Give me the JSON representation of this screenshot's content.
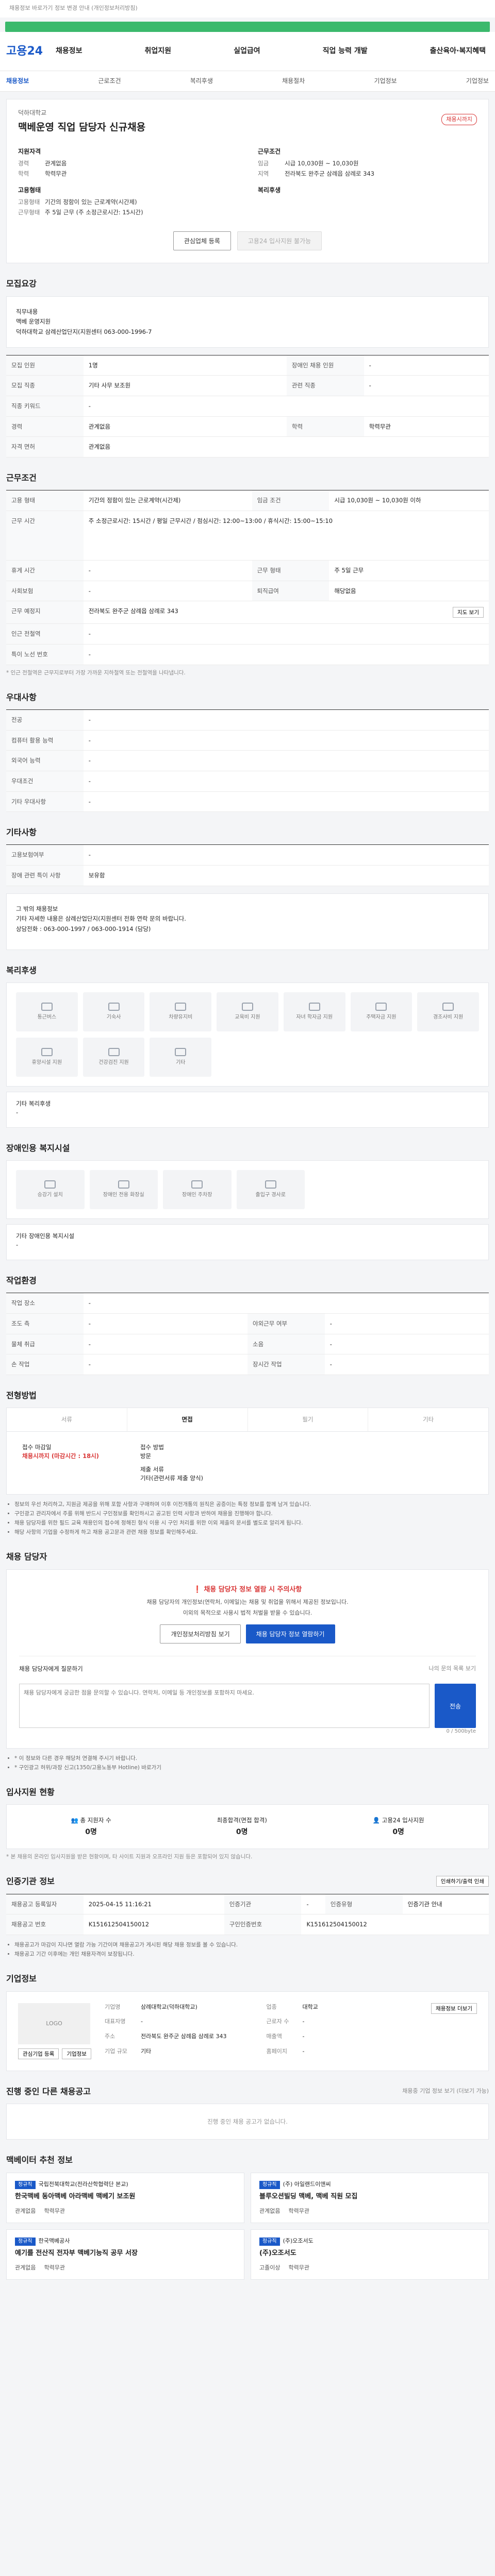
{
  "top": {
    "notice": "채용정보 바로가기 정보 변경 안내 (개인정보처리방침)"
  },
  "header": {
    "logo": "고용24",
    "nav": [
      "채용정보",
      "취업지원",
      "실업급여",
      "직업 능력 개발",
      "출산육아·복지혜택"
    ]
  },
  "subtabs": [
    "채용정보",
    "근로조건",
    "복리후생",
    "채용절차",
    "기업정보",
    "기업정보"
  ],
  "job": {
    "company": "덕하대학교",
    "title": "맥베운영 직업 담당자 신규채용",
    "badge": "채용시까지",
    "summary_left": {
      "title": "지원자격",
      "items": [
        {
          "k": "경력",
          "v": "관계없음"
        },
        {
          "k": "학력",
          "v": "학력무관"
        }
      ]
    },
    "summary_right": {
      "title": "근무조건",
      "items": [
        {
          "k": "임금",
          "v": "시급 10,030원 ~ 10,030원"
        },
        {
          "k": "지역",
          "v": "전라북도 완주군 삼례읍 삼례로 343"
        }
      ]
    },
    "summary_left2": {
      "title": "고용형태",
      "items": [
        {
          "k": "고용형태",
          "v": "기간의 정함이 있는 근로계약(시간제)"
        },
        {
          "k": "근무형태",
          "v": "주 5일 근무 (주 소정근로시간: 15시간)"
        }
      ]
    },
    "summary_right2": {
      "title": "복리후생",
      "items": [
        {
          "k": "",
          "v": ""
        }
      ]
    },
    "btn_interest": "관심업체 등록",
    "btn_apply": "고용24 입사지원 불가능"
  },
  "recruit": {
    "heading": "모집요강",
    "box": [
      "직무내용",
      "맥베 운영지원",
      "덕하대학교 삼례산업단지(지원센터 063-000-1996-7"
    ],
    "rows": [
      {
        "k": "모집 인원",
        "v": "1명",
        "k2": "장애인 채용 인원",
        "v2": "-"
      },
      {
        "k": "모집 직종",
        "v": "기타 사무 보조원",
        "k2": "관련 직종",
        "v2": "-"
      },
      {
        "k": "직종 키워드",
        "v": "-",
        "k2": "",
        "v2": ""
      },
      {
        "k": "경력",
        "v": "관계없음",
        "k2": "학력",
        "v2": "학력무관"
      },
      {
        "k": "자격 면허",
        "v": "관계없음",
        "k2": "",
        "v2": ""
      }
    ]
  },
  "conditions": {
    "heading": "근무조건",
    "rows": [
      {
        "k": "고용 형태",
        "v": "기간의 정함이 있는 근로계약(시간제)",
        "k2": "임금 조건",
        "v2": "시급 10,030원 ~ 10,030원 이하"
      },
      {
        "k": "근무 시간",
        "v": "주 소정근로시간: 15시간 / 평일 근무시간 / 점심시간: 12:00~13:00 / 휴식시간: 15:00~15:10",
        "k2": "",
        "v2": ""
      },
      {
        "k": "휴게 시간",
        "v": "-",
        "k2": "근무 형태",
        "v2": "주 5일 근무"
      },
      {
        "k": "사회보험",
        "v": "-",
        "k2": "퇴직급여",
        "v2": "해당없음"
      },
      {
        "k": "근무 예정지",
        "v": "전라북도 완주군 삼례읍 삼례로 343",
        "k2": "",
        "v2": ""
      },
      {
        "k": "인근 전철역",
        "v": "-",
        "k2": "",
        "v2": ""
      },
      {
        "k": "특이 노선 번호",
        "v": "-",
        "k2": "",
        "v2": ""
      }
    ],
    "map_btn": "지도 보기",
    "note": "* 인근 전철역은 근무지로부터 가장 가까운 지하철역 또는 전철역을 나타냅니다."
  },
  "preference": {
    "heading": "우대사항",
    "rows": [
      {
        "k": "전공",
        "v": "-"
      },
      {
        "k": "컴퓨터 활용 능력",
        "v": "-"
      },
      {
        "k": "외국어 능력",
        "v": "-"
      },
      {
        "k": "우대조건",
        "v": "-"
      },
      {
        "k": "기타 우대사항",
        "v": "-"
      }
    ]
  },
  "etc": {
    "heading": "기타사항",
    "rows": [
      {
        "k": "고용보험여부",
        "v": "-"
      },
      {
        "k": "장애 관련 특이 사항",
        "v": "보유함"
      }
    ],
    "box": [
      "그 밖의 채용정보",
      "기타 자세한 내용은 삼례산업단지(지원센터 전화 연락 문의 바랍니다.",
      "상담전화 : 063-000-1997 / 063-000-1914 (담당)"
    ]
  },
  "welfare": {
    "heading": "복리후생",
    "items": [
      "통근버스",
      "기숙사",
      "차량유지비",
      "교육비 지원",
      "자녀 학자금 지원",
      "주택자금 지원",
      "경조사비 지원",
      "휴양시설 지원",
      "건강검진 지원",
      "기타"
    ],
    "extra_title": "기타 복리후생",
    "extra": "-"
  },
  "disabled": {
    "heading": "장애인용 복지시설",
    "items": [
      "승강기 설치",
      "장애인 전용 화장실",
      "장애인 주차장",
      "출입구 경사로"
    ],
    "extra_title": "기타 장애인용 복지시설",
    "extra": "-"
  },
  "env": {
    "heading": "작업환경",
    "rows": [
      {
        "k": "작업 장소",
        "v": "-",
        "k2": "",
        "v2": ""
      },
      {
        "k": "조도 측",
        "v": "-",
        "k2": "야외근무 여부",
        "v2": "-"
      },
      {
        "k": "물체 취급",
        "v": "-",
        "k2": "소음",
        "v2": "-"
      },
      {
        "k": "손 작업",
        "v": "-",
        "k2": "장시간 작업",
        "v2": "-"
      }
    ]
  },
  "method": {
    "heading": "전형방법",
    "tabs": [
      "서류",
      "면접",
      "필기",
      "기타"
    ],
    "deadline_label": "접수 마감일",
    "deadline": "채용시까지 (마감시간 : 18시)",
    "method_label": "접수 방법",
    "method": "방문",
    "docs_label": "제출 서류",
    "docs": "기타(관련서류 제출 양식)",
    "bullets": [
      "정보의 우선 처리하고, 지원금 제공을 위해 포함 사항과 구매하며 이후 이전개통의 원칙은 공증이는 특정 정보를 함께 남겨 있습니다.",
      "구인광고 관리자에서 주를 위해 반드시 구인정보를 확인하시고 공고된 인력 사항과 반하여 채용을 진행해야 합니다.",
      "채용 담당자를 위한 필드 교육 채용인의 접수에 정해진 형식 이용 시 구인 처리를 위한 이외 제출의 문서를 별도로 알리게 됩니다.",
      "해당 사항의 기업을 수정하게 하고 채용 공고문과 관련 채용 정보를 확인해주세요."
    ]
  },
  "contact": {
    "heading": "채용 담당자",
    "warn": "채용 담당자 정보 열람 시 주의사항",
    "desc1": "채용 담당자의 개인정보(연락처, 이메일)는 채용 및 취업을 위해서 제공된 정보입니다.",
    "desc2": "이외의 목적으로 사용시 법적 처벌을 받을 수 있습니다.",
    "btn_view": "개인정보처리방침 보기",
    "btn_show": "채용 담당자 정보 열람하기",
    "qna_title": "채용 담당자에게 질문하기",
    "qna_link": "나의 문의 목록 보기",
    "qna_placeholder": "채용 담당자에게 궁금한 점을 문의할 수 있습니다. 연락처, 이메일 등 개인정보를 포함하지 마세요.",
    "counter": "0 / 500byte",
    "qna_btn": "전송",
    "bullets": [
      "* 이 정보와 다른 경우 해당처 연결해 주시기 바랍니다.",
      "* 구인광고 허위/과장 신고(1350/고용노동부 Hotline) 바로가기"
    ]
  },
  "status": {
    "heading": "입사지원 현황",
    "items": [
      {
        "label": "총 지원자 수",
        "value": "0명"
      },
      {
        "label": "최종합격(면접 합격)",
        "value": "0명"
      },
      {
        "label": "고용24 입사지원",
        "value": "0명"
      }
    ],
    "note": "* 본 채용의 온라인 입사지원을 받은 현황이며, 타 사이트 지원과 오프라인 지원 등은 포함되어 있지 않습니다."
  },
  "cert": {
    "heading": "인증기관 정보",
    "print_btn": "인쇄하기/출력 인쇄",
    "rows": [
      {
        "k": "채용공고 등록일자",
        "v": "2025-04-15 11:16:21",
        "k2": "인증기관",
        "v2": "-",
        "k3": "인증유형",
        "v3": "인증기관 안내"
      },
      {
        "k": "채용공고 번호",
        "v": "K151612504150012",
        "k2": "구인인증번호",
        "v2": "K151612504150012",
        "k3": "",
        "v3": ""
      }
    ],
    "bullets": [
      "채용공고가 마감이 지나면 열람 가능 기간이며 채용공고가 게시된 해당 채용 정보를 볼 수 있습니다.",
      "채용공고 기간 이후에는 개인 채용자격이 보장됩니다."
    ]
  },
  "company": {
    "heading": "기업정보",
    "logo": "LOGO",
    "btn_interest": "관심기업 등록",
    "btn_detail": "기업정보",
    "detail_btn": "채용정보 더보기",
    "info": [
      {
        "k": "기업명",
        "v": "삼례대학교(덕하대학교)"
      },
      {
        "k": "업종",
        "v": "대학교"
      },
      {
        "k": "대표자명",
        "v": "-"
      },
      {
        "k": "근로자 수",
        "v": "-"
      },
      {
        "k": "주소",
        "v": "전라북도 완주군 삼례읍 삼례로 343"
      },
      {
        "k": "매출액",
        "v": "-"
      },
      {
        "k": "기업 규모",
        "v": "기타"
      },
      {
        "k": "홈페이지",
        "v": "-"
      }
    ]
  },
  "more": {
    "heading": "진행 중인 다른 채용공고",
    "sub": "채용중 기업 정보 보기 (더보기 가능)",
    "empty": "진행 중인 채용 공고가 없습니다."
  },
  "recommend": {
    "heading": "맥베이터 추천 정보",
    "items": [
      {
        "tag": "정규직",
        "org": "국립전북대학교(전라산학협력단 본교)",
        "title": "한국맥베 동아맥베 아라맥베 맥베기 보조원",
        "a": "관계없음",
        "b": "학력무관"
      },
      {
        "tag": "정규직",
        "org": "(주) 아일랜드이앤씨",
        "title": "블루오션빌딩 맥베, 맥베 직원 모집",
        "a": "관계없음",
        "b": "학력무관"
      },
      {
        "tag": "정규직",
        "org": "한국맥베공사",
        "title": "예기를 전산직 전자부 맥베기능직 공무 서장",
        "a": "관계없음",
        "b": "학력무관"
      },
      {
        "tag": "정규직",
        "org": "(주)오조서도",
        "title": "(주)오조서도",
        "a": "고졸이상",
        "b": "학력무관"
      }
    ]
  }
}
